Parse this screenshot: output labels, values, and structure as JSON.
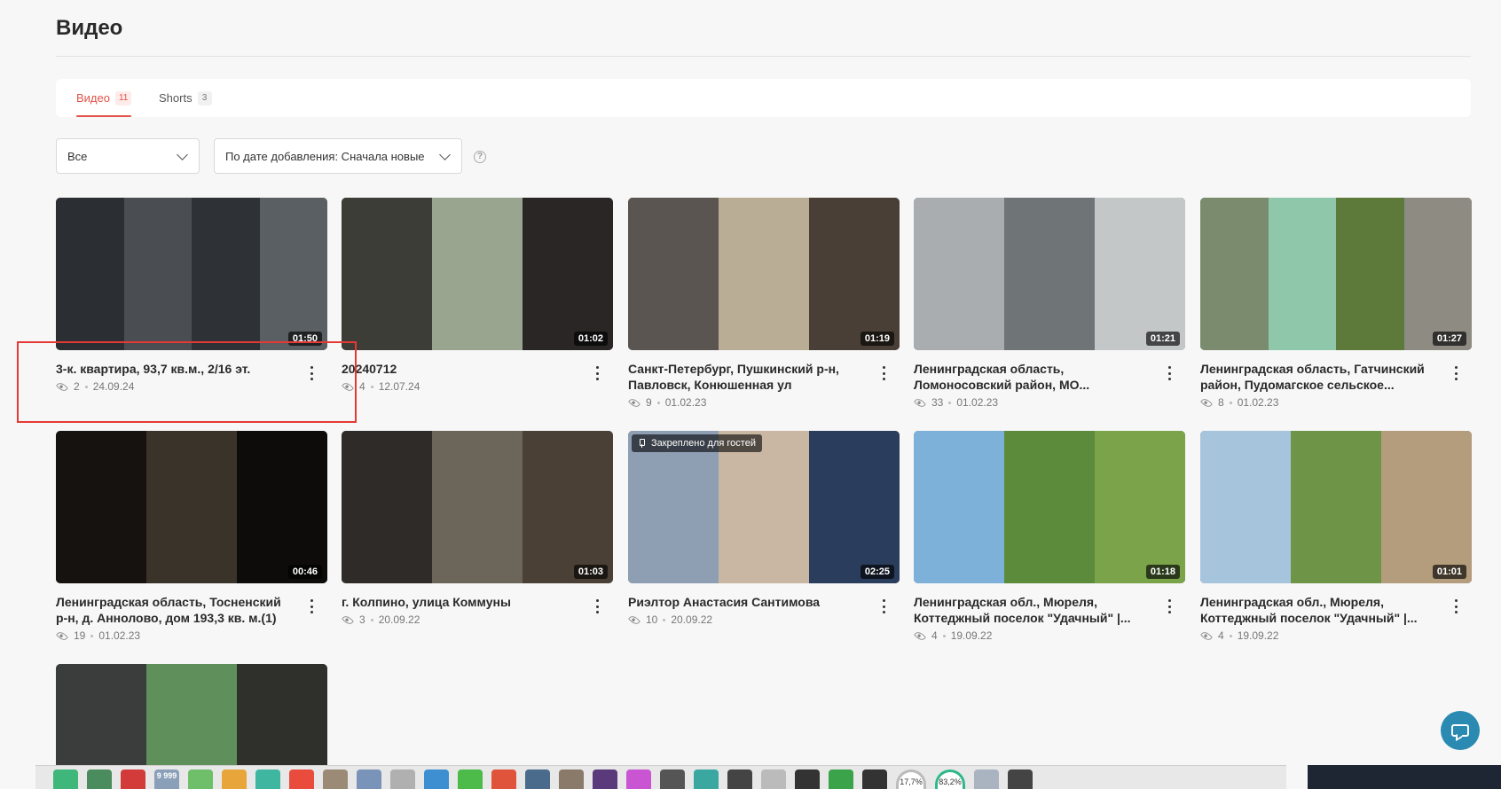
{
  "page": {
    "title": "Видео"
  },
  "tabs": [
    {
      "label": "Видео",
      "count": "11",
      "active": true
    },
    {
      "label": "Shorts",
      "count": "3",
      "active": false
    }
  ],
  "filters": {
    "type": "Все",
    "sort": "По дате добавления: Сначала новые",
    "help": "?"
  },
  "videos": [
    {
      "title": "3-к. квартира, 93,7 кв.м., 2/16 эт.",
      "views": "2",
      "date": "24.09.24",
      "duration": "01:50",
      "colors": [
        "#2b2e33",
        "#4a4d52",
        "#2e3135",
        "#5a5f63"
      ]
    },
    {
      "title": "20240712",
      "views": "4",
      "date": "12.07.24",
      "duration": "01:02",
      "colors": [
        "#3b3d36",
        "#9aa58f",
        "#2a2626"
      ]
    },
    {
      "title": "Санкт-Петербург, Пушкинский р-н, Павловск, Конюшенная ул",
      "views": "9",
      "date": "01.02.23",
      "duration": "01:19",
      "colors": [
        "#5a5550",
        "#b9ad96",
        "#4a3f36"
      ]
    },
    {
      "title": "Ленинградская область, Ломоносовский район, МО...",
      "views": "33",
      "date": "01.02.23",
      "duration": "01:21",
      "colors": [
        "#a9adb0",
        "#6f7477",
        "#c4c7c8"
      ]
    },
    {
      "title": "Ленинградская область, Гатчинский район, Пудомагское сельское...",
      "views": "8",
      "date": "01.02.23",
      "duration": "01:27",
      "colors": [
        "#7a8b6e",
        "#8fc7ab",
        "#5d7a3b",
        "#8e8b83"
      ]
    },
    {
      "title": "Ленинградская область, Тосненский р-н, д. Аннолово, дом 193,3 кв. м.(1)",
      "views": "19",
      "date": "01.02.23",
      "duration": "00:46",
      "colors": [
        "#15120f",
        "#3a332a",
        "#0d0c0a"
      ]
    },
    {
      "title": "г. Колпино, улица Коммуны",
      "views": "3",
      "date": "20.09.22",
      "duration": "01:03",
      "colors": [
        "#2e2b28",
        "#6b655a",
        "#4b4035"
      ]
    },
    {
      "title": "Риэлтор Анастасия Сантимова",
      "views": "10",
      "date": "20.09.22",
      "duration": "02:25",
      "pinned": "Закреплено для гостей",
      "colors": [
        "#8f9fb3",
        "#c9b7a3",
        "#2b3d5c"
      ]
    },
    {
      "title": "Ленинградская обл., Мюреля, Коттеджный поселок \"Удачный\" |...",
      "views": "4",
      "date": "19.09.22",
      "duration": "01:18",
      "colors": [
        "#7eb1d9",
        "#5d8b3c",
        "#7aa34a"
      ]
    },
    {
      "title": "Ленинградская обл., Мюреля, Коттеджный поселок \"Удачный\" |...",
      "views": "4",
      "date": "19.09.22",
      "duration": "01:01",
      "colors": [
        "#a7c4dd",
        "#6e9447",
        "#b49d7c"
      ]
    },
    {
      "title": "",
      "views": "",
      "date": "",
      "duration": "",
      "colors": [
        "#3a3d3b",
        "#5f8f5a",
        "#2f2f2c"
      ]
    }
  ],
  "taskbar": {
    "badge": "9 999",
    "cpu": "17,7%",
    "mem": "83,2%"
  },
  "colors": {
    "accent": "#e2534a",
    "chat": "#2a8ab1",
    "highlight": "#e53935"
  }
}
